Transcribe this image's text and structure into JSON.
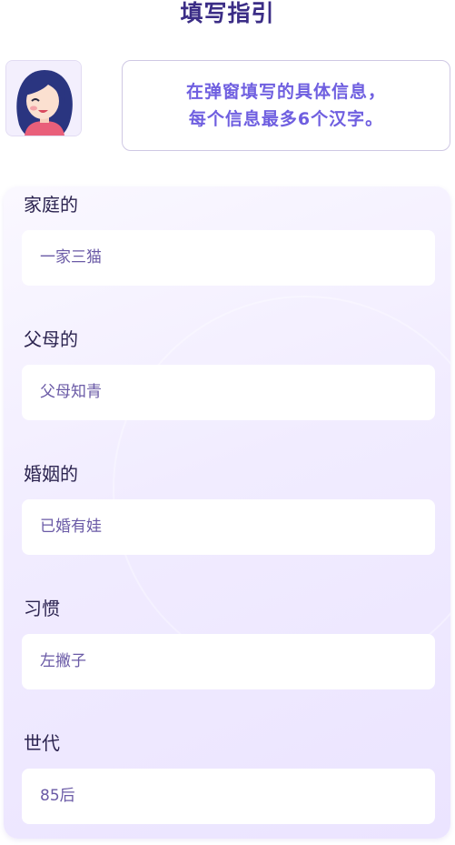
{
  "header": {
    "title": "填写指引"
  },
  "guide": {
    "line1": "在弹窗填写的具体信息，",
    "line2": "每个信息最多6个汉字。"
  },
  "fields": [
    {
      "label": "家庭的",
      "value": "一家三猫"
    },
    {
      "label": "父母的",
      "value": "父母知青"
    },
    {
      "label": "婚姻的",
      "value": "已婚有娃"
    },
    {
      "label": "习惯",
      "value": "左撇子"
    },
    {
      "label": "世代",
      "value": "85后"
    }
  ],
  "colors": {
    "title": "#3b2d86",
    "accent": "#6f5fe0",
    "label": "#2c2450",
    "value": "#6a5aa6"
  }
}
